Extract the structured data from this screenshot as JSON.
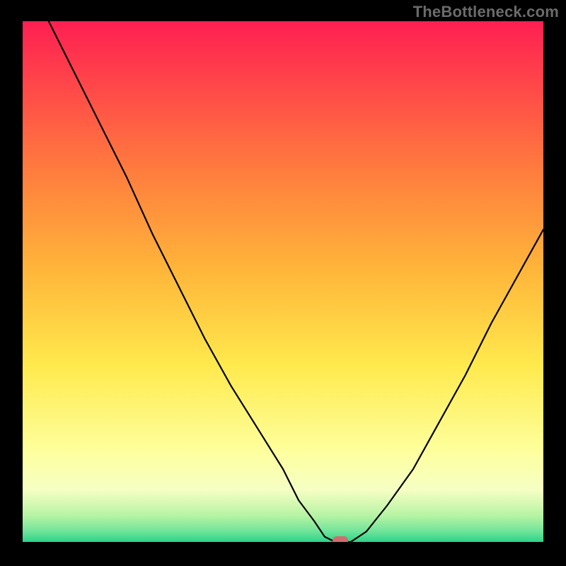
{
  "watermark": "TheBottleneck.com",
  "chart_data": {
    "type": "line",
    "title": "",
    "xlabel": "",
    "ylabel": "",
    "xlim": [
      0,
      100
    ],
    "ylim": [
      0,
      100
    ],
    "grid": false,
    "legend": false,
    "background_gradient": {
      "top": "#ff1f52",
      "upper_mid": "#ffb63a",
      "mid": "#ffe94d",
      "lower_mid": "#f6ffc4",
      "near_bottom": "#b6f3a3",
      "bottom": "#2bd38a"
    },
    "series": [
      {
        "name": "bottleneck-curve",
        "x": [
          5,
          10,
          15,
          20,
          25,
          30,
          35,
          40,
          45,
          50,
          53,
          56,
          58,
          60,
          63,
          66,
          70,
          75,
          80,
          85,
          90,
          95,
          100
        ],
        "y": [
          100,
          90,
          80,
          70,
          59,
          49,
          39,
          30,
          22,
          14,
          8,
          4,
          1,
          0,
          0,
          2,
          7,
          14,
          23,
          32,
          42,
          51,
          60
        ]
      }
    ],
    "marker": {
      "name": "optimal-point",
      "x": 61,
      "y": 0,
      "color": "#d36a6f",
      "shape": "pill"
    }
  }
}
